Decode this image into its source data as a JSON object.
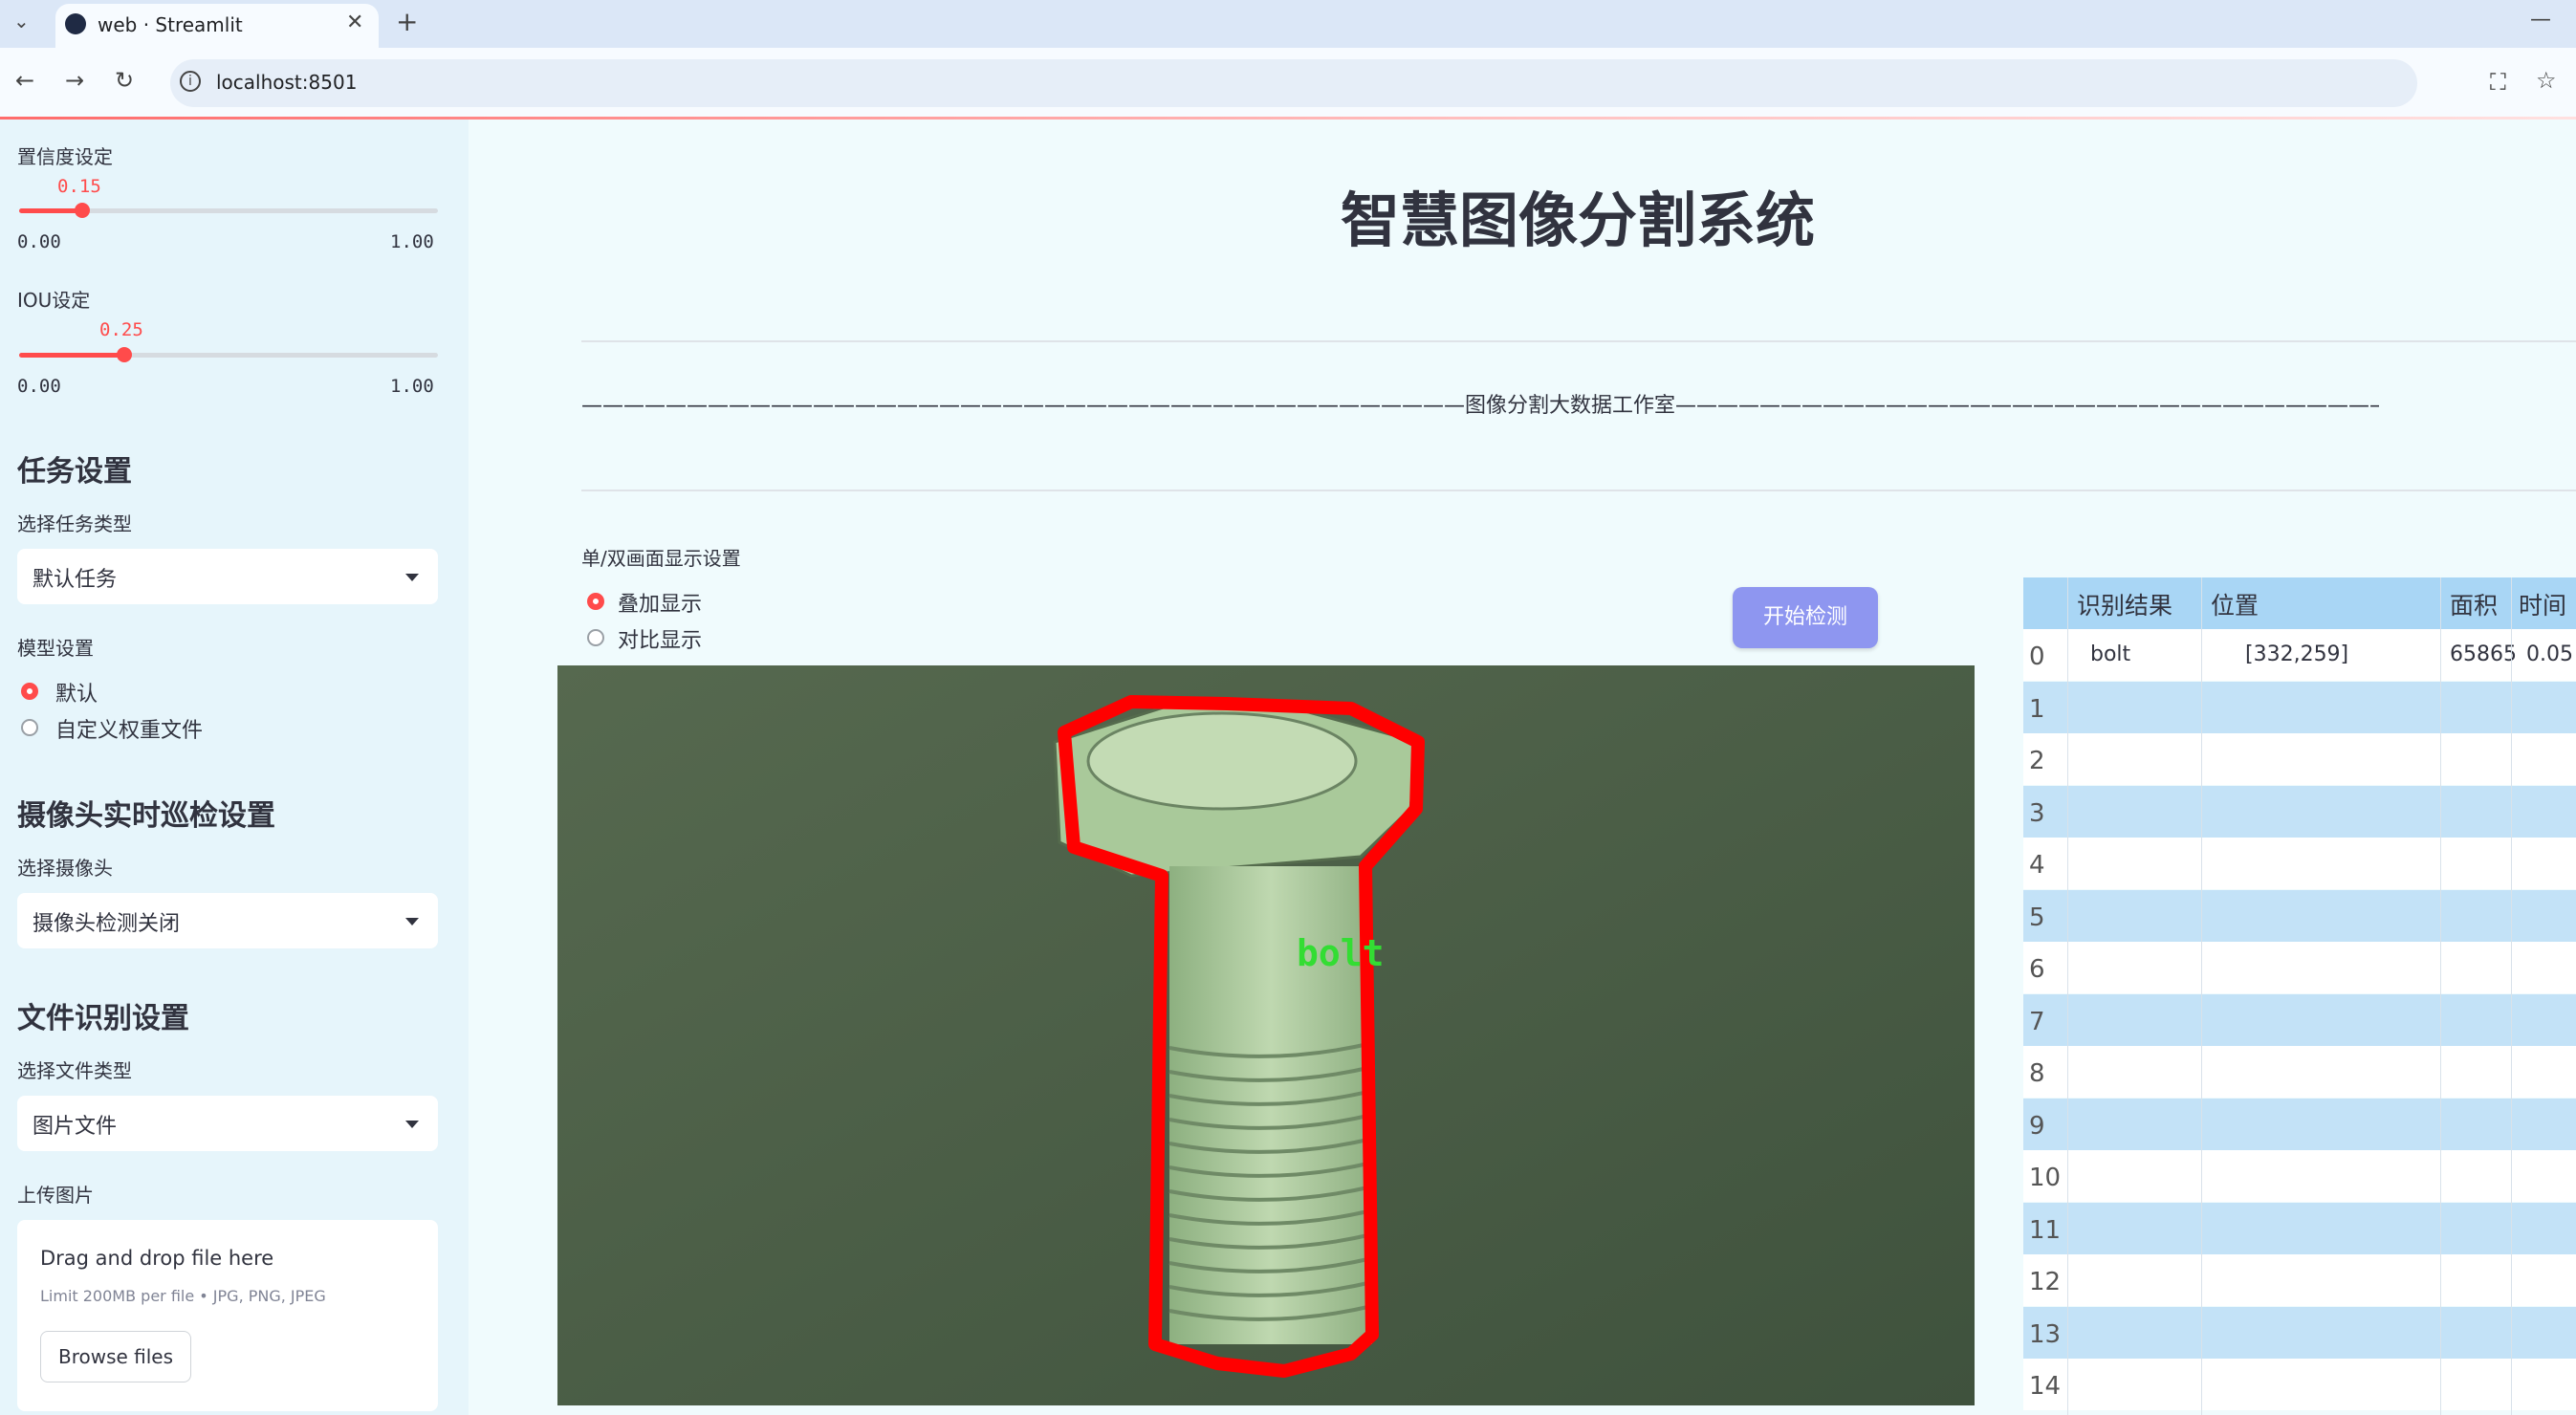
{
  "browser": {
    "tab_title": "web · Streamlit",
    "url": "localhost:8501"
  },
  "sidebar": {
    "confidence": {
      "label": "置信度设定",
      "value": "0.15",
      "fraction": 0.15,
      "min": "0.00",
      "max": "1.00"
    },
    "iou": {
      "label": "IOU设定",
      "value": "0.25",
      "fraction": 0.25,
      "min": "0.00",
      "max": "1.00"
    },
    "task_section": {
      "heading": "任务设置",
      "label": "选择任务类型",
      "selected": "默认任务"
    },
    "model_section": {
      "label": "模型设置",
      "options": [
        "默认",
        "自定义权重文件"
      ],
      "selected_index": 0
    },
    "camera_section": {
      "heading": "摄像头实时巡检设置",
      "label": "选择摄像头",
      "selected": "摄像头检测关闭"
    },
    "file_section": {
      "heading": "文件识别设置",
      "label": "选择文件类型",
      "selected": "图片文件"
    },
    "upload": {
      "label": "上传图片",
      "drop_text": "Drag and drop file here",
      "limit_text": "Limit 200MB per file • JPG, PNG, JPEG",
      "browse_label": "Browse files"
    }
  },
  "main": {
    "title": "智慧图像分割系统",
    "workshop_line": "——————————————————————————————————————————图像分割大数据工作室——————————————————————————————————————————",
    "display_setting_label": "单/双画面显示设置",
    "display_options": [
      "叠加显示",
      "对比显示"
    ],
    "display_selected_index": 0,
    "start_button": "开始检测",
    "detection_label": "bolt"
  },
  "results_table": {
    "headers": [
      "识别结果",
      "位置",
      "面积",
      "时间"
    ],
    "rows": [
      {
        "index": "0",
        "result": "bolt",
        "position": "[332,259]",
        "area": "65865",
        "time": "0.05"
      },
      {
        "index": "1"
      },
      {
        "index": "2"
      },
      {
        "index": "3"
      },
      {
        "index": "4"
      },
      {
        "index": "5"
      },
      {
        "index": "6"
      },
      {
        "index": "7"
      },
      {
        "index": "8"
      },
      {
        "index": "9"
      },
      {
        "index": "10"
      },
      {
        "index": "11"
      },
      {
        "index": "12"
      },
      {
        "index": "13"
      },
      {
        "index": "14"
      }
    ]
  },
  "colors": {
    "accent": "#ff4b4b",
    "button": "#8e96f0",
    "table_header": "#a9d6f5",
    "table_stripe": "#c3e2f7",
    "mask_outline": "#ff0000",
    "label_green": "#33dd33"
  }
}
